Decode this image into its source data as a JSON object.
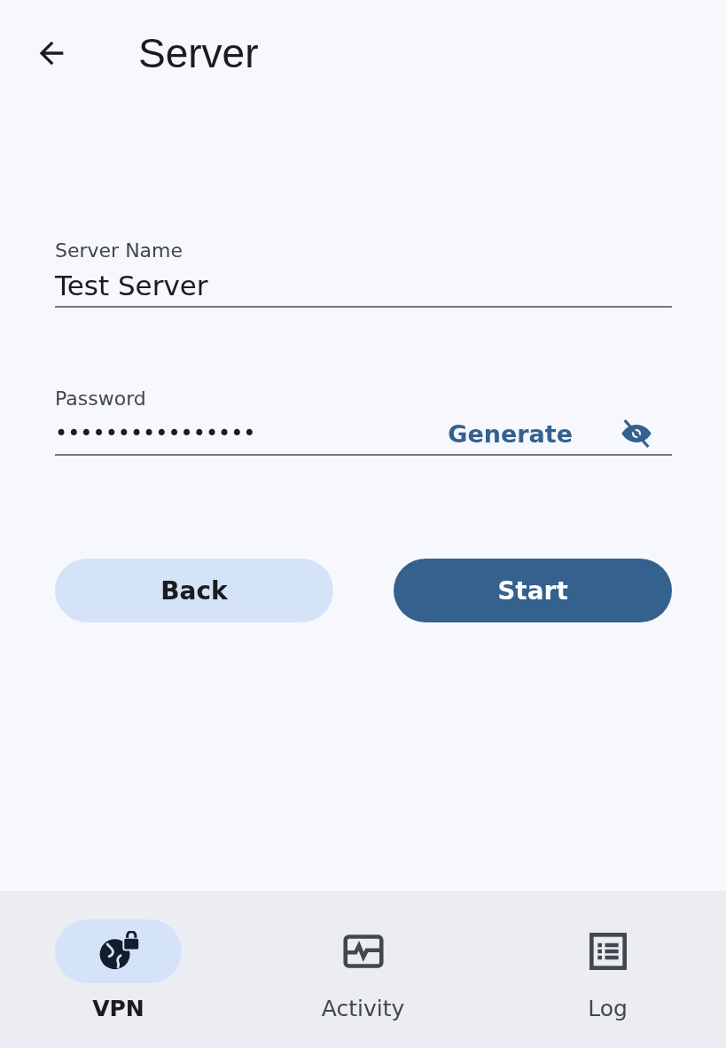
{
  "header": {
    "title": "Server"
  },
  "fields": [
    {
      "kind": "text",
      "label": "Server Name",
      "value": "Test Server"
    },
    {
      "kind": "password",
      "label": "Password",
      "value": "••••••••••••••••",
      "action": "Generate",
      "visible": false
    }
  ],
  "buttons": [
    {
      "label": "Back",
      "kind": "secondary"
    },
    {
      "label": "Start",
      "kind": "primary"
    }
  ],
  "nav": [
    {
      "label": "VPN",
      "kind": "vpn",
      "selected": true
    },
    {
      "label": "Activity",
      "kind": "activity",
      "selected": false
    },
    {
      "label": "Log",
      "kind": "log",
      "selected": false
    }
  ]
}
